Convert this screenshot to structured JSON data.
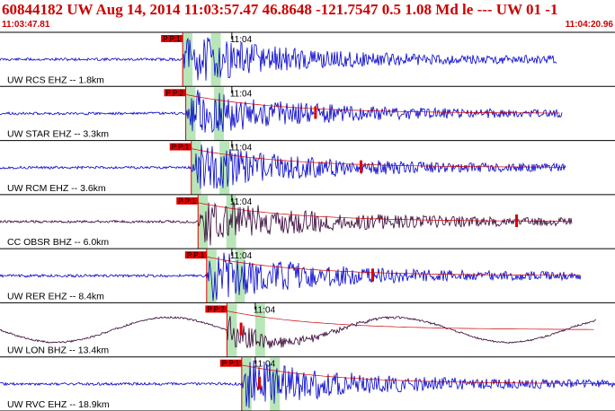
{
  "header": {
    "title": "60844182 UW Aug 14, 2014 11:03:57.47    46.8648 -121.7547  0.5 1.08 Md le --- UW 01   -1",
    "start_time": "11:03:47.81",
    "end_time": "11:04:20.96"
  },
  "colors": {
    "title": "#cc0000",
    "trace_blue": "#0000cc",
    "trace_dark": "#330033",
    "pick_bg": "#dd0000",
    "pick_window": "#b8e6b8",
    "coda": "#cc0000"
  },
  "clock_label": "11:04",
  "traces": [
    {
      "label": "UW RCS EHZ -- 1.8km",
      "pick": "P P:1",
      "color": "blue",
      "p_frac": 0.297,
      "tmid_frac": 0.377,
      "end_frac": 0.905,
      "style": "burst",
      "seed": 11
    },
    {
      "label": "UW STAR EHZ -- 3.3km",
      "pick": "P P:2",
      "color": "blue",
      "p_frac": 0.302,
      "tmid_frac": 0.377,
      "end_frac": 0.915,
      "style": "burst",
      "seed": 23,
      "coda_frac": 0.513
    },
    {
      "label": "UW RCM EHZ -- 3.6km",
      "pick": "P P:1",
      "color": "blue",
      "p_frac": 0.311,
      "tmid_frac": 0.377,
      "end_frac": 0.92,
      "style": "burst",
      "seed": 37,
      "coda_frac": 0.587
    },
    {
      "label": "CC OBSR BHZ -- 6.0km",
      "pick": "P P:1",
      "color": "dark",
      "p_frac": 0.322,
      "tmid_frac": 0.377,
      "end_frac": 0.93,
      "style": "burst",
      "seed": 41,
      "coda_frac": 0.84
    },
    {
      "label": "UW RER EHZ -- 8.4km",
      "pick": "P P:1",
      "color": "blue",
      "p_frac": 0.336,
      "tmid_frac": 0.377,
      "end_frac": 0.945,
      "style": "burst",
      "seed": 53,
      "coda_frac": 0.606
    },
    {
      "label": "UW LON BHZ -- 13.4km",
      "pick": "P P:2",
      "color": "dark",
      "p_frac": 0.369,
      "tmid_frac": 0.415,
      "end_frac": 0.97,
      "style": "long",
      "seed": 61,
      "coda_frac": 0.392
    },
    {
      "label": "UW RVC EHZ -- 18.9km",
      "pick": "P P:1",
      "color": "blue",
      "p_frac": 0.393,
      "tmid_frac": 0.415,
      "end_frac": 1.0,
      "style": "burst",
      "seed": 71,
      "coda_frac": 0.422
    }
  ]
}
